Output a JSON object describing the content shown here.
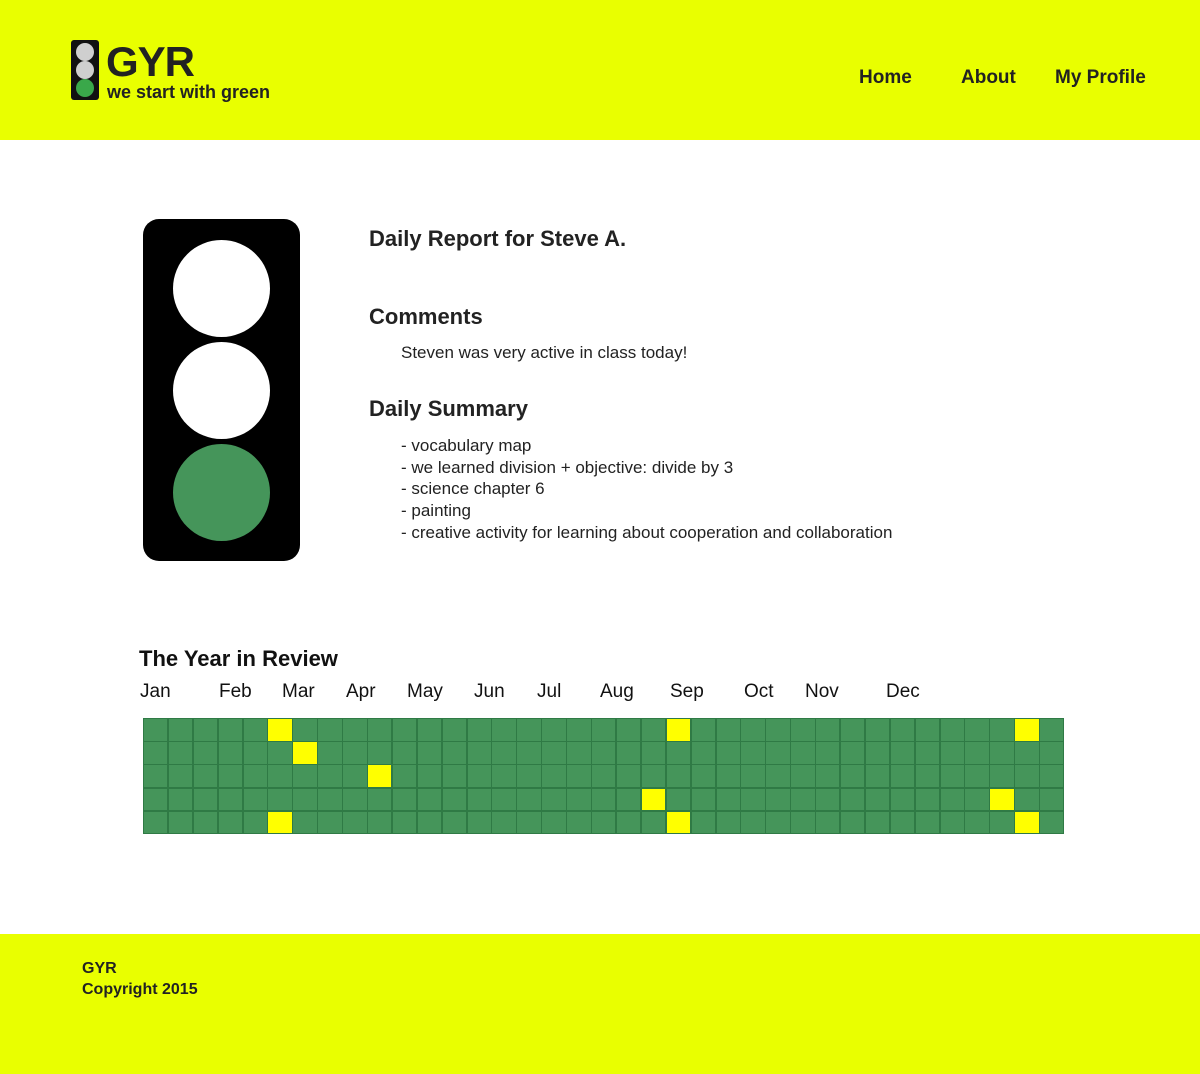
{
  "header": {
    "brand": "GYR",
    "tagline": "we start with green",
    "logo_icon": "traffic-light-icon",
    "nav": [
      {
        "label": "Home"
      },
      {
        "label": "About"
      },
      {
        "label": "My Profile"
      }
    ]
  },
  "colors": {
    "brand_yellow": "#e9ff00",
    "green": "#45955a",
    "yellow_cell": "#ffff00",
    "light_off": "#ffffff",
    "light_housing": "#000000",
    "logo_off": "#cccccc",
    "logo_green": "#3aa84a"
  },
  "status_light": {
    "icon": "traffic-light-icon",
    "active": "green"
  },
  "report": {
    "title": "Daily Report for Steve A.",
    "comments_heading": "Comments",
    "comment": "Steven was very active in class today!",
    "summary_heading": "Daily Summary",
    "summary_items": [
      "- vocabulary map",
      "- we learned division + objective: divide by 3",
      "- science chapter 6",
      "- painting",
      "- creative activity for learning about cooperation and collaboration"
    ]
  },
  "year_review": {
    "title": "The Year in Review",
    "months": [
      "Jan",
      "Feb",
      "Mar",
      "Apr",
      "May",
      "Jun",
      "Jul",
      "Aug",
      "Sep",
      "Oct",
      "Nov",
      "Dec"
    ],
    "weeks": 37,
    "days_per_week": 5,
    "yellow_days": [
      {
        "week": 5,
        "day": 0
      },
      {
        "week": 6,
        "day": 1
      },
      {
        "week": 9,
        "day": 2
      },
      {
        "week": 5,
        "day": 4
      },
      {
        "week": 21,
        "day": 0
      },
      {
        "week": 20,
        "day": 3
      },
      {
        "week": 21,
        "day": 4
      },
      {
        "week": 35,
        "day": 0
      },
      {
        "week": 34,
        "day": 3
      },
      {
        "week": 35,
        "day": 4
      }
    ]
  },
  "footer": {
    "brand": "GYR",
    "copyright": "Copyright 2015"
  }
}
